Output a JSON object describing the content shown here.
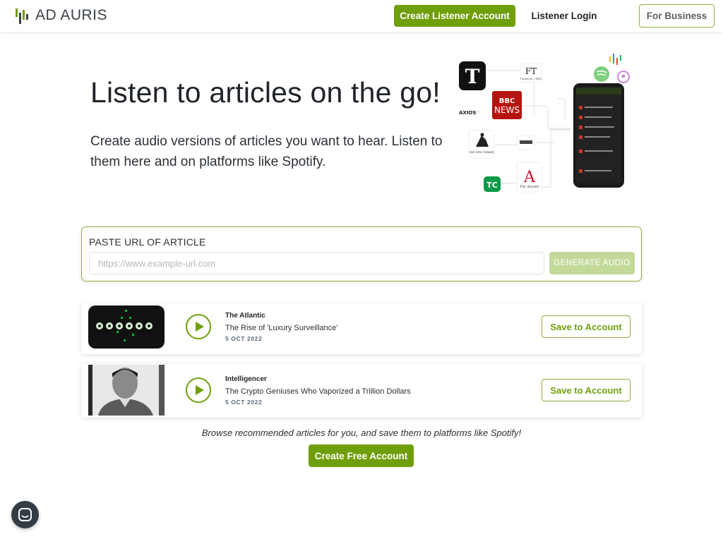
{
  "header": {
    "logo_text": "AD AURIS",
    "create_listener_label": "Create Listener Account",
    "login_label": "Listener Login",
    "business_label": "For Business"
  },
  "hero": {
    "title": "Listen to articles on the go!",
    "subtitle": "Create audio versions of articles you want to hear. Listen to them here and on platforms like Spotify.",
    "publisher_logos": {
      "ft": "FT",
      "ft_small": "FINANCIAL TIMES",
      "bbc_top": "BBC",
      "bbc_bottom": "NEWS",
      "axios": "AXIOS",
      "new_yorker": "THE NEW YORKER",
      "tc": "TC",
      "atlantic_letter": "A",
      "atlantic": "The Atlantic"
    }
  },
  "url_form": {
    "label": "PASTE URL OF ARTICLE",
    "placeholder": "https://www.example-url.com",
    "generate_label": "GENERATE AUDIO"
  },
  "articles": [
    {
      "publication": "The Atlantic",
      "title": "The Rise of 'Luxury Surveillance'",
      "date": "5 OCT 2022",
      "save_label": "Save to Account"
    },
    {
      "publication": "Intelligencer",
      "title": "The Crypto Geniuses Who Vaporized a Trillion Dollars",
      "date": "5 OCT 2022",
      "save_label": "Save to Account"
    }
  ],
  "browse_text": "Browse recommended articles for you, and save them to platforms like Spotify!",
  "free_account_label": "Create Free Account",
  "colors": {
    "accent": "#6f9f0b",
    "accent_light": "#c3d99a",
    "text": "#1f2429"
  }
}
